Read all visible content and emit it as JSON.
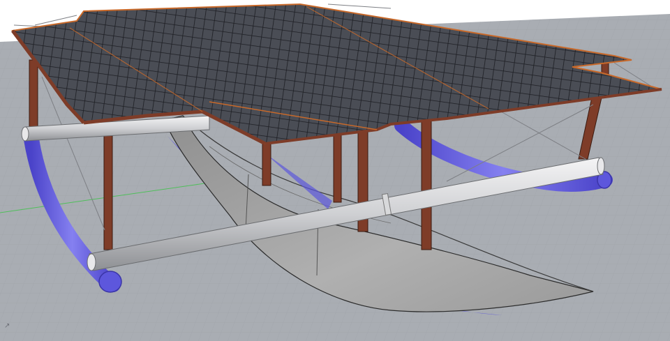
{
  "scene": {
    "background_color": "#ffffff",
    "ground_color": "#a9adb3",
    "grid_line_color": "#9ea2a8",
    "axis_line_color": "#4fbf5a",
    "panel_fill": "#4a4d55",
    "panel_grid_line": "#1c1d22",
    "panel_edge": "#c8692a",
    "frame_color": "#7e3c28",
    "pipe_color": "#d9dadc",
    "float_color": "#6a64e6",
    "hull_color": "#a7a7a7"
  }
}
